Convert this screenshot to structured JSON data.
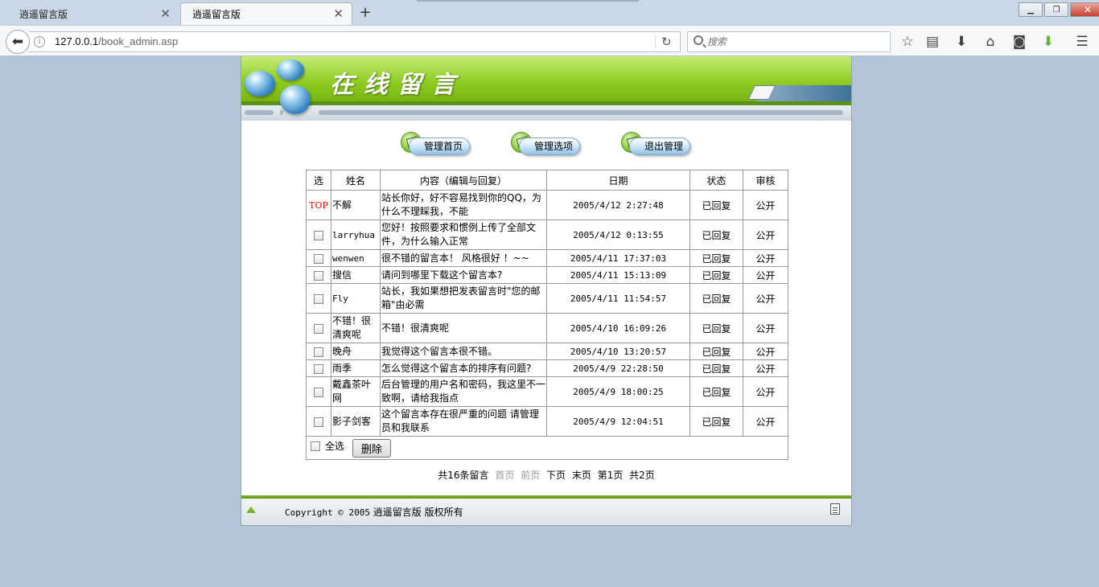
{
  "browser": {
    "tabs": [
      {
        "title": "逍遥留言版",
        "active": false
      },
      {
        "title": "逍遥留言版",
        "active": true
      }
    ],
    "new_tab_symbol": "+",
    "url_host": "127.0.0.1",
    "url_path": "/book_admin.asp",
    "search_placeholder": "搜索"
  },
  "banner": {
    "title": "在线留言"
  },
  "menu": [
    {
      "label": "管理首页"
    },
    {
      "label": "管理选项"
    },
    {
      "label": "退出管理"
    }
  ],
  "table": {
    "headers": [
      "选",
      "姓名",
      "内容（编辑与回复）",
      "日期",
      "状态",
      "审核"
    ],
    "rows": [
      {
        "sel": "TOP",
        "name": "不解",
        "content": "站长你好，好不容易找到你的QQ，为什么不理睬我，不能",
        "date": "2005/4/12 2:27:48",
        "status": "已回复",
        "audit": "公开"
      },
      {
        "sel": "",
        "name": "larryhua",
        "content": "您好！按照要求和惯例上传了全部文件，为什么输入正常",
        "date": "2005/4/12 0:13:55",
        "status": "已回复",
        "audit": "公开"
      },
      {
        "sel": "",
        "name": "wenwen",
        "content": "很不错的留言本！ 风格很好 ！~~",
        "date": "2005/4/11 17:37:03",
        "status": "已回复",
        "audit": "公开"
      },
      {
        "sel": "",
        "name": "搜信",
        "content": "请问到哪里下载这个留言本?",
        "date": "2005/4/11 15:13:09",
        "status": "已回复",
        "audit": "公开"
      },
      {
        "sel": "",
        "name": "Fly",
        "content": "站长，我如果想把发表留言时\"您的邮箱\"由必需",
        "date": "2005/4/11 11:54:57",
        "status": "已回复",
        "audit": "公开"
      },
      {
        "sel": "",
        "name": "不错！很清爽呢",
        "content": "不错！很清爽呢",
        "date": "2005/4/10 16:09:26",
        "status": "已回复",
        "audit": "公开"
      },
      {
        "sel": "",
        "name": "晚舟",
        "content": "我觉得这个留言本很不错。",
        "date": "2005/4/10 13:20:57",
        "status": "已回复",
        "audit": "公开"
      },
      {
        "sel": "",
        "name": "雨季",
        "content": "怎么觉得这个留言本的排序有问题?",
        "date": "2005/4/9 22:28:50",
        "status": "已回复",
        "audit": "公开"
      },
      {
        "sel": "",
        "name": "戴鑫茶叶网",
        "content": "后台管理的用户名和密码，我这里不一致啊，请给我指点",
        "date": "2005/4/9 18:00:25",
        "status": "已回复",
        "audit": "公开"
      },
      {
        "sel": "",
        "name": "影子剑客",
        "content": "这个留言本存在很严重的问题 请管理员和我联系",
        "date": "2005/4/9 12:04:51",
        "status": "已回复",
        "audit": "公开"
      }
    ],
    "select_all_label": "全选",
    "delete_label": "删除"
  },
  "pager": {
    "total": "共16条留言",
    "first": "首页",
    "prev": "前页",
    "next": "下页",
    "last": "末页",
    "current": "第1页",
    "pages": "共2页"
  },
  "footer": {
    "copyright": "Copyright © 2005",
    "site": "逍遥留言版",
    "rights": "版权所有"
  }
}
